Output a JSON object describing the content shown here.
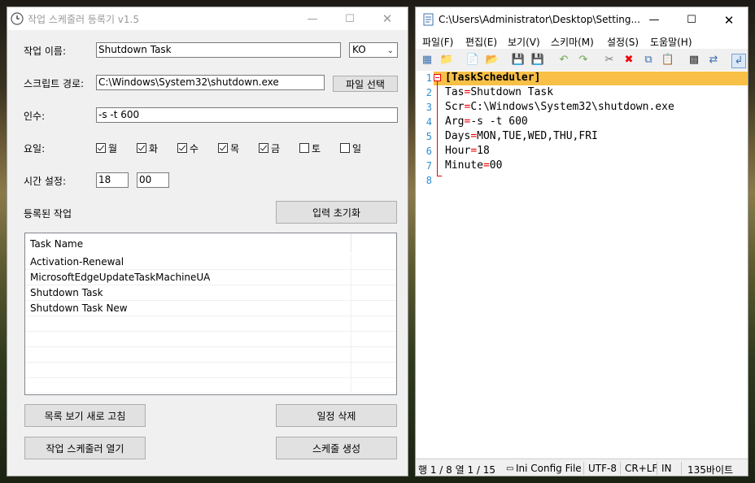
{
  "left_window": {
    "title": "작업 스케줄러 등록기 v1.5",
    "task_name_label": "작업 이름:",
    "task_name_value": "Shutdown Task",
    "lang_value": "KO",
    "script_path_label": "스크립트 경로:",
    "script_path_value": "C:\\Windows\\System32\\shutdown.exe",
    "file_select_button": "파일 선택",
    "args_label": "인수:",
    "args_value": "-s -t 600",
    "days_label": "요일:",
    "days": [
      {
        "label": "월",
        "checked": true
      },
      {
        "label": "화",
        "checked": true
      },
      {
        "label": "수",
        "checked": true
      },
      {
        "label": "목",
        "checked": true
      },
      {
        "label": "금",
        "checked": true
      },
      {
        "label": "토",
        "checked": false
      },
      {
        "label": "일",
        "checked": false
      }
    ],
    "time_label": "시간 설정:",
    "hour_value": "18",
    "minute_value": "00",
    "registered_label": "등록된 작업",
    "reset_button": "입력 초기화",
    "list_header": "Task Name",
    "tasks": [
      "Activation-Renewal",
      "MicrosoftEdgeUpdateTaskMachineUA",
      "Shutdown Task",
      "Shutdown Task New"
    ],
    "refresh_button": "목록 보기 새로 고침",
    "delete_button": "일정 삭제",
    "open_scheduler_button": "작업 스케줄러 열기",
    "create_schedule_button": "스케줄 생성"
  },
  "right_window": {
    "title": "C:\\Users\\Administrator\\Desktop\\Setting...",
    "menus": [
      "파일(F)",
      "편집(E)",
      "보기(V)",
      "스키마(M)",
      "설정(S)",
      "도움말(H)"
    ],
    "lines": [
      {
        "num": "1",
        "key": "[TaskScheduler]",
        "val": ""
      },
      {
        "num": "2",
        "key": "Tas",
        "val": "Shutdown Task"
      },
      {
        "num": "3",
        "key": "Scr",
        "val": "C:\\Windows\\System32\\shutdown.exe"
      },
      {
        "num": "4",
        "key": "Arg",
        "val": "-s -t 600"
      },
      {
        "num": "5",
        "key": "Days",
        "val": "MON,TUE,WED,THU,FRI"
      },
      {
        "num": "6",
        "key": "Hour",
        "val": "18"
      },
      {
        "num": "7",
        "key": "Minute",
        "val": "00"
      },
      {
        "num": "8",
        "key": "",
        "val": ""
      }
    ],
    "status": {
      "position": "행 1 / 8  열 1 / 15",
      "type_icon": "▭",
      "filetype": "Ini Config File",
      "encoding": "UTF-8",
      "eol": "CR+LF",
      "mode": "IN",
      "size": "135바이트"
    }
  },
  "colors": {
    "highlight": "#f8c046",
    "fold_marker": "#e00000",
    "line_number": "#2b8fd6"
  }
}
